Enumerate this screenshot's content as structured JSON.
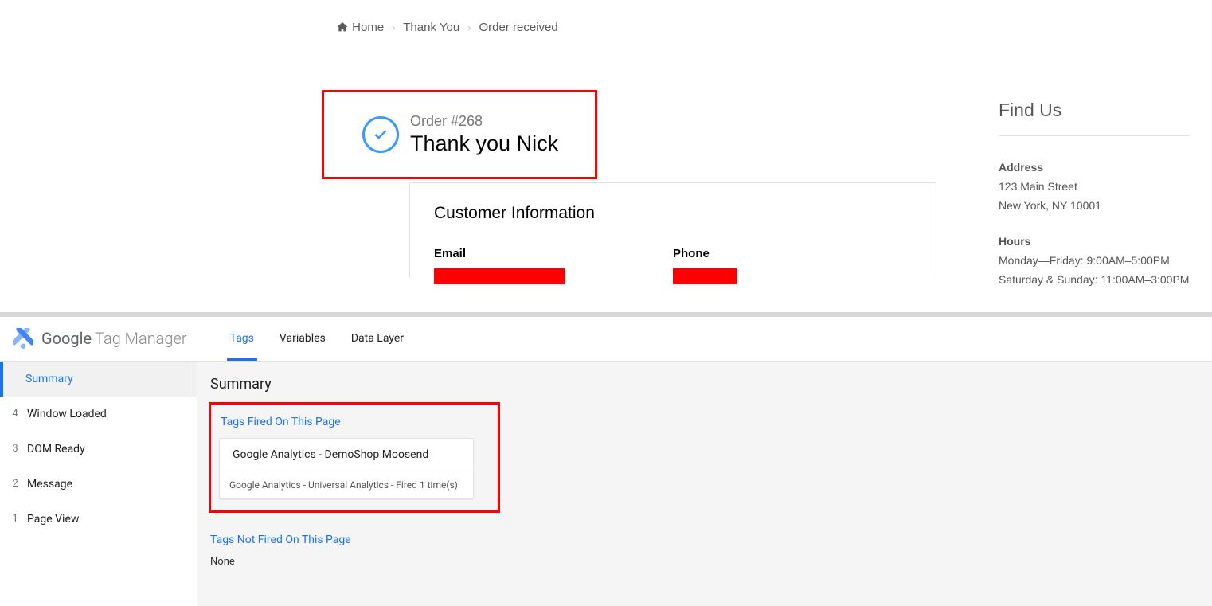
{
  "breadcrumbs": {
    "home": "Home",
    "thank": "Thank You",
    "order": "Order received"
  },
  "confirm": {
    "order": "Order #268",
    "thank": "Thank you Nick"
  },
  "customer": {
    "title": "Customer Information",
    "email_label": "Email",
    "phone_label": "Phone"
  },
  "findus": {
    "title": "Find Us",
    "address_label": "Address",
    "address_line1": "123 Main Street",
    "address_line2": "New York, NY 10001",
    "hours_label": "Hours",
    "hours_line1": "Monday—Friday: 9:00AM–5:00PM",
    "hours_line2": "Saturday & Sunday: 11:00AM–3:00PM"
  },
  "gtm": {
    "brand_g": "Google",
    "brand_tm": "Tag Manager",
    "tabs": {
      "tags": "Tags",
      "variables": "Variables",
      "datalayer": "Data Layer"
    },
    "left": {
      "summary": "Summary",
      "events": [
        {
          "num": "4",
          "label": "Window Loaded"
        },
        {
          "num": "3",
          "label": "DOM Ready"
        },
        {
          "num": "2",
          "label": "Message"
        },
        {
          "num": "1",
          "label": "Page View"
        }
      ]
    },
    "right": {
      "title": "Summary",
      "fired_head": "Tags Fired On This Page",
      "tag_title": "Google Analytics - DemoShop Moosend",
      "tag_sub": "Google Analytics - Universal Analytics - Fired 1 time(s)",
      "not_fired_head": "Tags Not Fired On This Page",
      "none": "None"
    }
  }
}
